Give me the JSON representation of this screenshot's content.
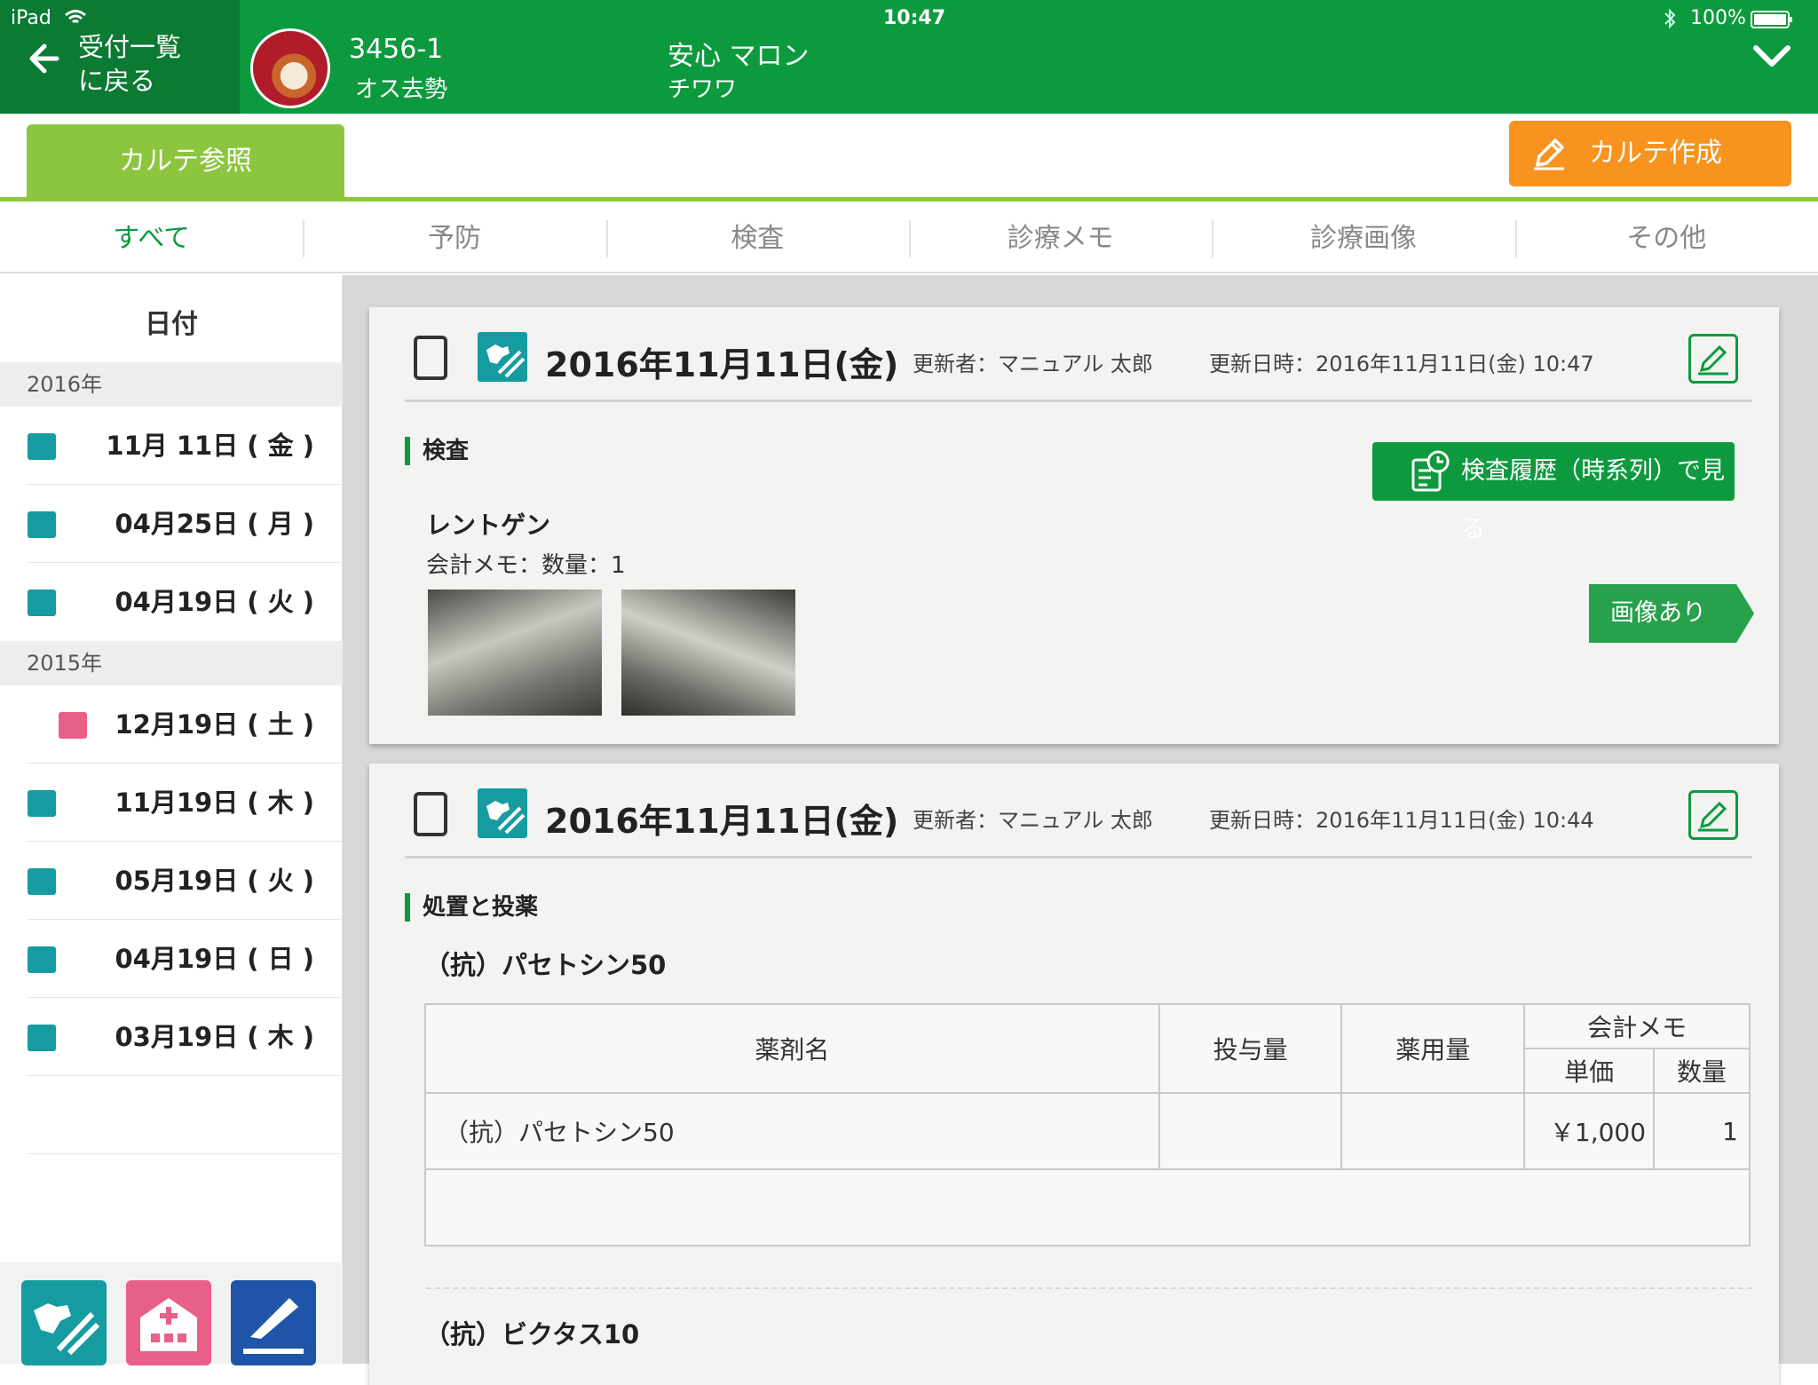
{
  "status_bar": {
    "device": "iPad",
    "time": "10:47",
    "battery": "100%"
  },
  "header": {
    "back_label": "受付一覧\nに戻る",
    "patient_id": "3456-1",
    "sex": "オス去勢",
    "name": "安心 マロン",
    "breed": "チワワ",
    "icons": [
      "back-arrow-icon",
      "chevron-down-icon",
      "wifi-icon",
      "bluetooth-icon",
      "battery-icon"
    ]
  },
  "toolbar": {
    "view_tab": "カルテ参照",
    "create_button": "カルテ作成"
  },
  "filters": [
    "すべて",
    "予防",
    "検査",
    "診療メモ",
    "診療画像",
    "その他"
  ],
  "active_filter": "すべて",
  "sidebar": {
    "title": "日付",
    "groups": [
      {
        "year": "2016年",
        "dates": [
          {
            "date": "11月 11日 ( 金 )",
            "icon": "treatment-icon"
          },
          {
            "date": "04月25日 ( 月 )",
            "icon": "treatment-icon"
          },
          {
            "date": "04月19日 ( 火 )",
            "icon": "treatment-icon"
          }
        ]
      },
      {
        "year": "2015年",
        "dates": [
          {
            "date": "12月19日 ( 土 )",
            "icon": "hospital-icon"
          },
          {
            "date": "11月19日 ( 木 )",
            "icon": "treatment-icon"
          },
          {
            "date": "05月19日 ( 火 )",
            "icon": "treatment-icon"
          },
          {
            "date": "04月19日 ( 日 )",
            "icon": "treatment-icon"
          },
          {
            "date": "03月19日 ( 木 )",
            "icon": "treatment-icon"
          }
        ]
      }
    ],
    "bottom_buttons": [
      "treatment-button",
      "hospital-button",
      "surgery-button"
    ]
  },
  "records": [
    {
      "date": "2016年11月11日(金)",
      "updater": "更新者：マニュアル 太郎",
      "updated_at": "更新日時：2016年11月11日(金) 10:47",
      "section": "検査",
      "history_button": "検査履歴（時系列）で見る",
      "item_name": "レントゲン",
      "memo": "会計メモ：数量：1",
      "image_badge": "画像あり"
    },
    {
      "date": "2016年11月11日(金)",
      "updater": "更新者：マニュアル 太郎",
      "updated_at": "更新日時：2016年11月11日(金) 10:44",
      "section": "処置と投薬",
      "drug_title": "（抗）パセトシン50",
      "table": {
        "headers": {
          "drug": "薬剤名",
          "dose": "投与量",
          "usage": "薬用量",
          "memo": "会計メモ",
          "unit_price": "単価",
          "qty": "数量"
        },
        "rows": [
          {
            "drug": "（抗）パセトシン50",
            "dose": "",
            "usage": "",
            "unit_price": "￥1,000",
            "qty": "1"
          }
        ]
      },
      "next_drug_title": "（抗）ビクタス10"
    }
  ]
}
